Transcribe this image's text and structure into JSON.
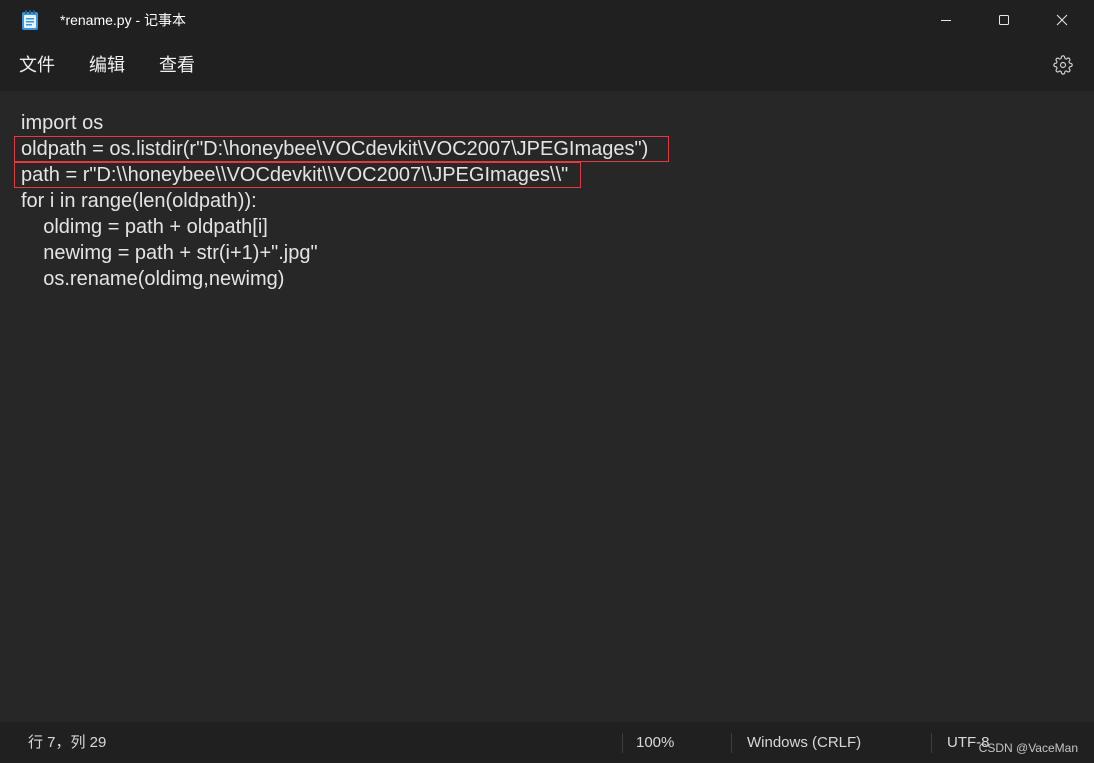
{
  "window": {
    "title": "*rename.py - 记事本",
    "app_icon": "notepad-icon",
    "controls": {
      "minimize": "minimize-icon",
      "maximize": "maximize-icon",
      "close": "close-icon"
    }
  },
  "menu": {
    "items": [
      {
        "label": "文件"
      },
      {
        "label": "编辑"
      },
      {
        "label": "查看"
      }
    ],
    "settings_icon": "gear-icon"
  },
  "editor": {
    "lines": [
      {
        "text": "import os"
      },
      {
        "text": "oldpath = os.listdir(r\"D:\\honeybee\\VOCdevkit\\VOC2007\\JPEGImages\")"
      },
      {
        "text": "path = r\"D:\\\\honeybee\\\\VOCdevkit\\\\VOC2007\\\\JPEGImages\\\\\""
      },
      {
        "text": "for i in range(len(oldpath)):"
      },
      {
        "text": "    oldimg = path + oldpath[i]"
      },
      {
        "text": "    newimg = path + str(i+1)+\".jpg\""
      },
      {
        "text": "    os.rename(oldimg,newimg)"
      }
    ]
  },
  "status_bar": {
    "cursor_position": "行 7，列 29",
    "zoom": "100%",
    "line_ending": "Windows (CRLF)",
    "encoding": "UTF-8"
  },
  "watermark": "CSDN @VaceMan",
  "colors": {
    "chrome_bg": "#202020",
    "editor_bg": "#272727",
    "text": "#e4e4e4",
    "annotation": "#e23a3f"
  }
}
